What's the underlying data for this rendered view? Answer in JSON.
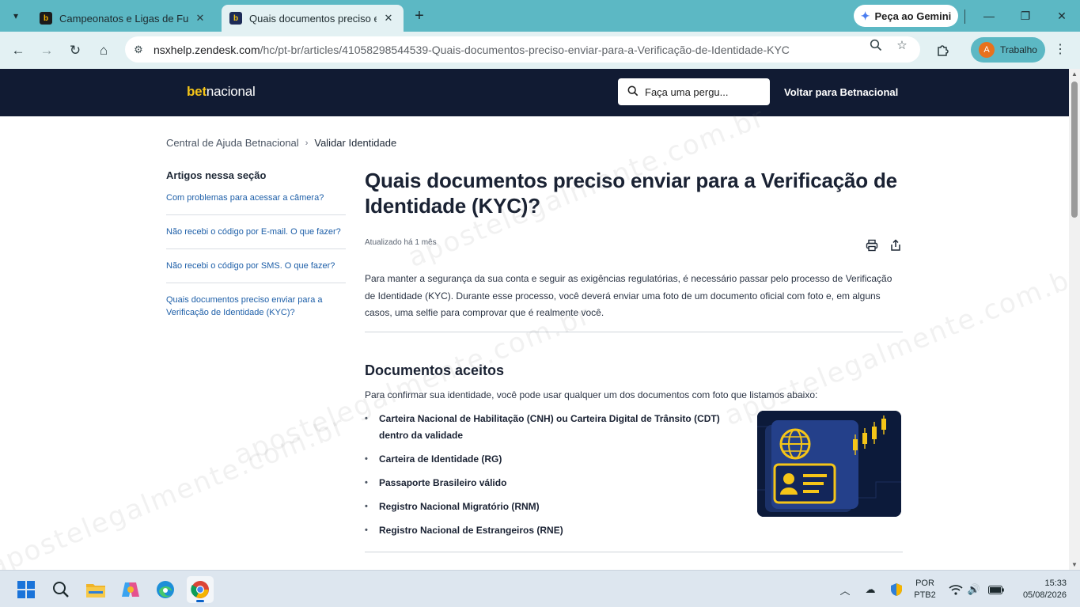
{
  "browser": {
    "tabs": [
      {
        "title": "Campeonatos e Ligas de Futebol",
        "favicon": "b"
      },
      {
        "title": "Quais documentos preciso enviar",
        "favicon": "b"
      }
    ],
    "gemini_label": "Peça ao Gemini",
    "url_host": "nsxhelp.zendesk.com",
    "url_path": "/hc/pt-br/articles/41058298544539-Quais-documentos-preciso-enviar-para-a-Verificação-de-Identidade-KYC",
    "profile_initial": "A",
    "profile_name": "Trabalho"
  },
  "site": {
    "logo_bet": "bet",
    "logo_nacional": "nacional",
    "search_placeholder": "Faça uma pergu...",
    "back_link": "Voltar para Betnacional"
  },
  "breadcrumb": [
    "Central de Ajuda Betnacional",
    "Validar Identidade"
  ],
  "sidebar": {
    "heading": "Artigos nessa seção",
    "items": [
      "Com problemas para acessar a câmera?",
      "Não recebi o código por E-mail. O que fazer?",
      "Não recebi o código por SMS. O que fazer?",
      "Quais documentos preciso enviar para a Verificação de Identidade (KYC)?"
    ]
  },
  "article": {
    "title": "Quais documentos preciso enviar para a Verificação de Identidade (KYC)?",
    "updated": "Atualizado há 1 mês",
    "intro": "Para manter a segurança da sua conta e seguir as exigências regulatórias, é necessário passar pelo processo de Verificação de Identidade (KYC). Durante esse processo, você deverá enviar uma foto de um documento oficial com foto e, em alguns casos, uma selfie para comprovar que é realmente você.",
    "section_title": "Documentos aceitos",
    "section_lead": "Para confirmar sua identidade, você pode usar qualquer um dos documentos com foto que listamos abaixo:",
    "documents": [
      "Carteira Nacional de Habilitação (CNH) ou Carteira Digital de Trânsito (CDT) dentro da validade",
      "Carteira de Identidade (RG)",
      "Passaporte Brasileiro válido",
      "Registro Nacional Migratório (RNM)",
      "Registro Nacional de Estrangeiros (RNE)"
    ]
  },
  "watermark_text": "apostelegalmente.com.br",
  "taskbar": {
    "lang_line1": "POR",
    "lang_line2": "PTB2",
    "time": "15:33",
    "date": "05/08/2026"
  },
  "colors": {
    "header_bg": "#111b33",
    "accent_yellow": "#f5c518",
    "link_blue": "#1e5fa8",
    "chrome_teal": "#5cb8c4"
  }
}
